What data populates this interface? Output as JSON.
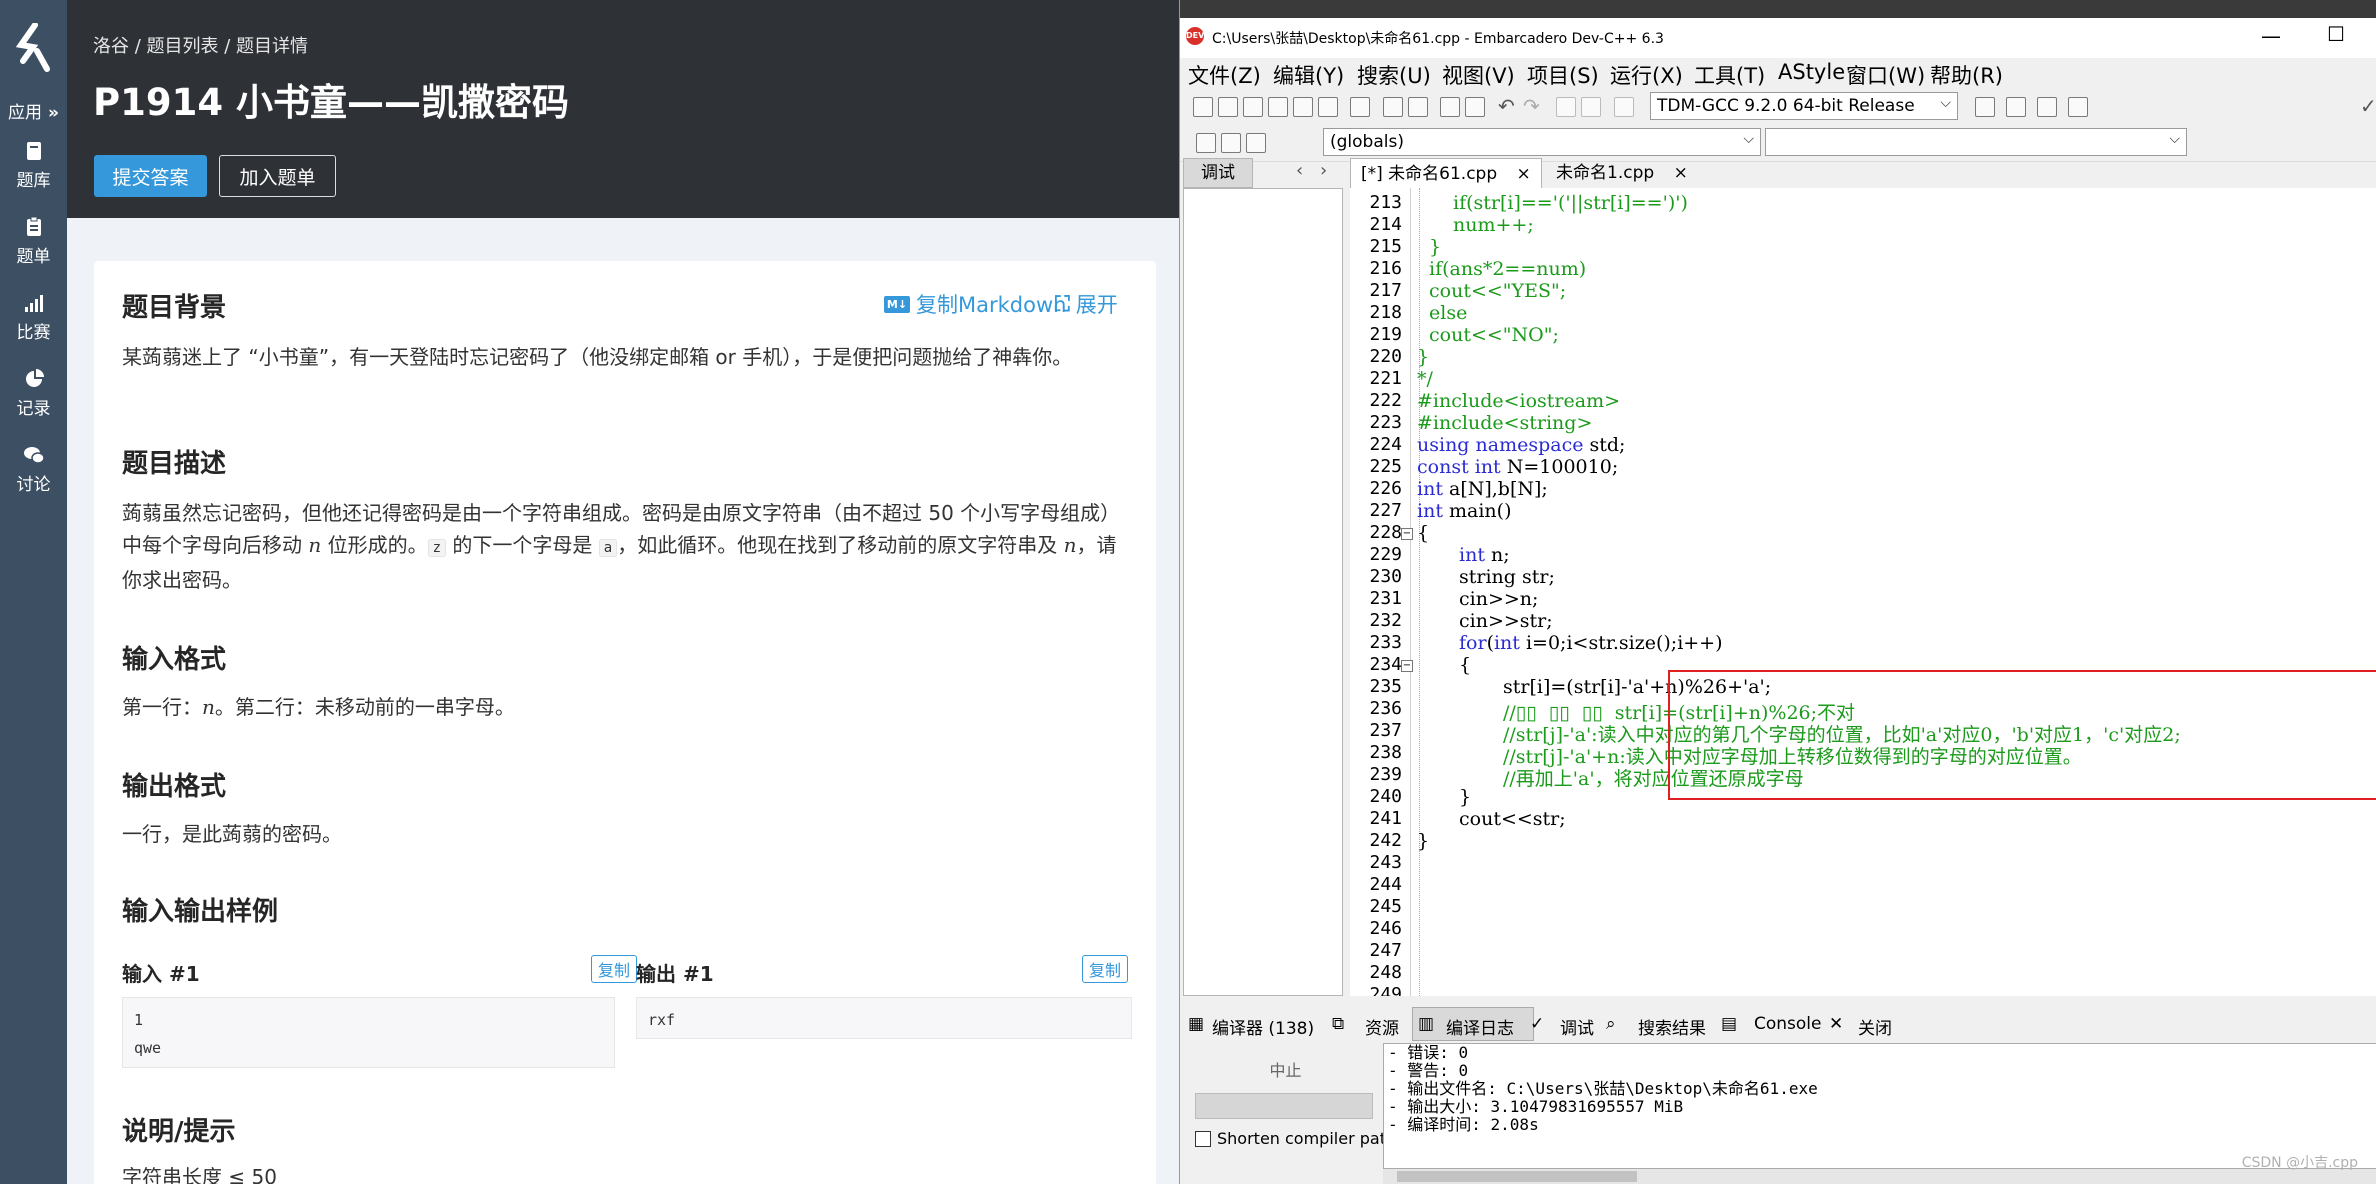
{
  "sidebar": {
    "app_label": "应用",
    "items": [
      {
        "label": "题库",
        "icon": "book-icon"
      },
      {
        "label": "题单",
        "icon": "clipboard-icon"
      },
      {
        "label": "比赛",
        "icon": "bar-chart-icon"
      },
      {
        "label": "记录",
        "icon": "pie-chart-icon"
      },
      {
        "label": "讨论",
        "icon": "chat-icon"
      }
    ]
  },
  "luogu": {
    "breadcrumb": "洛谷 / 题目列表 / 题目详情",
    "title": "P1914 小书童——凯撒密码",
    "submit_label": "提交答案",
    "add_label": "加入题单",
    "copy_md_label": "复制Markdown",
    "expand_label": "展开",
    "background_heading": "题目背景",
    "background_text": "某蒟蒻迷上了 “小书童”，有一天登陆时忘记密码了（他没绑定邮箱 or 手机），于是便把问题抛给了神犇你。",
    "desc_heading": "题目描述",
    "desc_text_1": "蒟蒻虽然忘记密码，但他还记得密码是由一个字符串组成。密码是由原文字符串（由不超过 50 个小写字母组成）中每个字母向后移动 ",
    "desc_var_n": "n",
    "desc_text_2": " 位形成的。",
    "desc_code_z": "z",
    "desc_text_3": " 的下一个字母是 ",
    "desc_code_a": "a",
    "desc_text_4": "，如此循环。他现在找到了移动前的原文字符串及 ",
    "desc_text_5": "，请你求出密码。",
    "input_heading": "输入格式",
    "input_text_1": "第一行：",
    "input_text_2": "。第二行：未移动前的一串字母。",
    "output_heading": "输出格式",
    "output_text": "一行，是此蒟蒻的密码。",
    "sample_heading": "输入输出样例",
    "input1_label": "输入 #1",
    "output1_label": "输出 #1",
    "copy_label": "复制",
    "input1_line1": "1",
    "input1_line2": "qwe",
    "output1_line1": "rxf",
    "hint_heading": "说明/提示",
    "hint_text": "字符串长度 ≤ 50"
  },
  "ide": {
    "title": "C:\\Users\\张喆\\Desktop\\未命名61.cpp - Embarcadero Dev-C++ 6.3",
    "menu": [
      "文件(Z)",
      "编辑(Y)",
      "搜索(U)",
      "视图(V)",
      "项目(S)",
      "运行(X)",
      "工具(T)",
      "AStyle",
      "窗口(W)",
      "帮助(R)"
    ],
    "compiler_select": "TDM-GCC 9.2.0 64-bit Release",
    "scope_select": "(globals)",
    "debug_tab": "调试",
    "file_tabs": [
      "[*] 未命名61.cpp",
      "未命名1.cpp"
    ],
    "line_numbers": [
      "213",
      "214",
      "215",
      "216",
      "217",
      "218",
      "219",
      "220",
      "221",
      "222",
      "223",
      "224",
      "225",
      "226",
      "227",
      "228",
      "229",
      "230",
      "231",
      "232",
      "233",
      "234",
      "235",
      "236",
      "237",
      "238",
      "239",
      "240",
      "241",
      "242",
      "243",
      "244",
      "245",
      "246",
      "247",
      "248",
      "249"
    ],
    "code": {
      "l213": "if(str[i]=='('||str[i]==')')",
      "l214": "num++;",
      "l215": "}",
      "l216": "if(ans*2==num)",
      "l217": "cout<<\"YES\";",
      "l218": "else",
      "l219": "cout<<\"NO\";",
      "l220": "}",
      "l221": "*/",
      "l222": "#include<iostream>",
      "l223": "#include<string>",
      "l224_kw": "using namespace",
      "l224_rest": " std;",
      "l225_kw": "const int",
      "l225_rest": " N=100010;",
      "l226_kw": "int",
      "l226_rest": " a[N],b[N];",
      "l227_kw": "int",
      "l227_rest": " main()",
      "l228": "{",
      "l229_kw": "int",
      "l229_rest": " n;",
      "l230": "string str;",
      "l231": "cin>>n;",
      "l232": "cin>>str;",
      "l233_kw": "for",
      "l233_p": "(",
      "l233_kw2": "int",
      "l233_rest": " i=0;i<str.size();i++)",
      "l234": "{",
      "l235": "str[i]=(str[i]-'a'+n)%26+'a';",
      "l236": "//▯▯  ▯▯  ▯▯  str[i]=(str[i]+n)%26;不对",
      "l237": "//str[j]-'a':读入中对应的第几个字母的位置，比如'a'对应0，'b'对应1，'c'对应2;",
      "l238": "//str[j]-'a'+n:读入中对应字母加上转移位数得到的字母的对应位置。",
      "l239": "//再加上'a'，将对应位置还原成字母",
      "l240": "}",
      "l241": "cout<<str;",
      "l242": "}"
    },
    "bottom_tabs": [
      "编译器 (138)",
      "资源",
      "编译日志",
      "调试",
      "搜索结果",
      "Console",
      "关闭"
    ],
    "abort_label": "中止",
    "shorten_label": "Shorten compiler pat",
    "log_lines": [
      "- 错误: 0",
      "- 警告: 0",
      "- 输出文件名: C:\\Users\\张喆\\Desktop\\未命名61.exe",
      "- 输出大小: 3.10479831695557 MiB",
      "- 编译时间: 2.08s"
    ],
    "watermark": "CSDN @小吉.cpp"
  },
  "colors": {
    "sidebar_bg": "#3d4f63",
    "header_bg": "#2e3136",
    "accent": "#3498db",
    "keyword": "#2b2bd3",
    "comment": "#1b9a1b",
    "highlight_box": "#e02020"
  }
}
